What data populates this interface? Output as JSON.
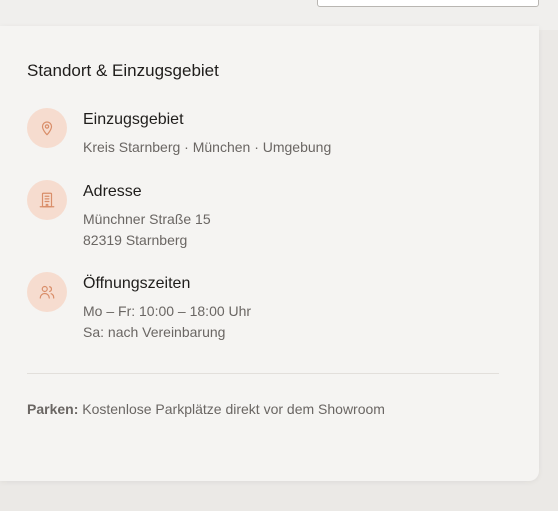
{
  "section": {
    "title": "Standort & Einzugsgebiet"
  },
  "items": [
    {
      "icon": "map-pin-icon",
      "title": "Einzugsgebiet",
      "lines": [
        "Kreis Starnberg · München · Umgebung"
      ]
    },
    {
      "icon": "building-icon",
      "title": "Adresse",
      "lines": [
        "Münchner Straße 15",
        "82319 Starnberg"
      ]
    },
    {
      "icon": "users-icon",
      "title": "Öffnungszeiten",
      "lines": [
        "Mo – Fr: 10:00 – 18:00 Uhr",
        "Sa: nach Vereinbarung"
      ]
    }
  ],
  "parking": {
    "label": "Parken:",
    "text": " Kostenlose Parkplätze direkt vor dem Showroom"
  },
  "colors": {
    "accent": "#d98e6a",
    "accent_bg": "#f6dccf",
    "card_bg": "#f5f4f2",
    "page_bg": "#ebe9e6"
  }
}
